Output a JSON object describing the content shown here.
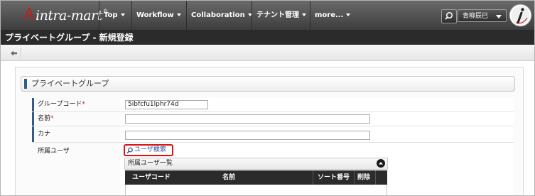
{
  "header": {
    "logo_text": "intra-mart",
    "logo_reg": "®",
    "nav": [
      {
        "label": "Top"
      },
      {
        "label": "Workflow"
      },
      {
        "label": "Collaboration"
      },
      {
        "label": "テナント管理"
      },
      {
        "label": "more..."
      }
    ],
    "user_name": "青柳辰巳"
  },
  "page": {
    "title": "プライベートグループ - 新規登録"
  },
  "toolbar": {
    "back_icon": "arrow-left-icon"
  },
  "section": {
    "title": "プライベートグループ"
  },
  "form": {
    "group_code_label": "グループコード",
    "group_code_value": "5ibfcfu1lphr74d",
    "name_label": "名前",
    "kana_label": "カナ",
    "required_mark": "*",
    "member_label": "所属ユーザ",
    "user_search_link": "ユーザ検索"
  },
  "member_list": {
    "title": "所属ユーザ一覧",
    "columns": [
      "ユーザコード",
      "名前",
      "ソート番号",
      "削除"
    ]
  },
  "colors": {
    "topbar": "#4a4a4a",
    "titlebar": "#2b2b2b",
    "accent_bar": "#2f5c8a",
    "highlight_border": "#d11111",
    "link": "#1f4d9b"
  }
}
